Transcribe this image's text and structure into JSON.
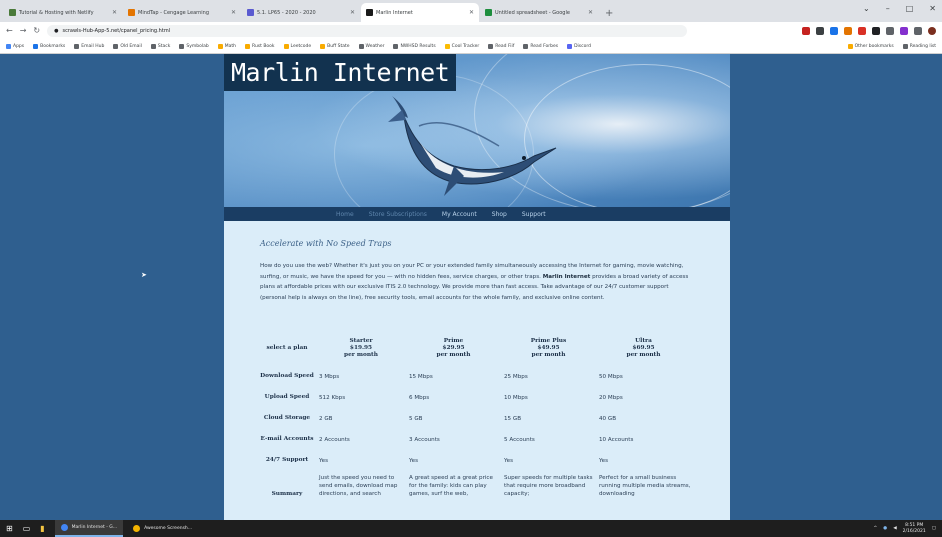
{
  "browser": {
    "tabs": [
      {
        "label": "Tutorial & Hosting with Netlify",
        "color": "#4a7a3a",
        "active": false
      },
      {
        "label": "MindTap - Cengage Learning",
        "color": "#e37400",
        "active": false
      },
      {
        "label": "5.1. LP65 - 2020 - 2020",
        "color": "#5a5ad0",
        "active": false
      },
      {
        "label": "Marlin Internet",
        "color": "#1a1a1a",
        "active": true
      },
      {
        "label": "Untitled spreadsheet - Google",
        "color": "#1e8e3e",
        "active": false
      }
    ],
    "new_tab": "+",
    "window_controls": [
      "⌄",
      "–",
      "□",
      "✕"
    ],
    "url": "scrawls-Hub-App-5.net/cpanel_pricing.html",
    "bookmarks": [
      {
        "label": "Apps",
        "color": "#4285f4"
      },
      {
        "label": "Bookmarks",
        "color": "#1a73e8"
      },
      {
        "label": "Email Hub",
        "color": "#5f6368"
      },
      {
        "label": "Old Email",
        "color": "#5f6368"
      },
      {
        "label": "Stack",
        "color": "#5f6368"
      },
      {
        "label": "Symbolab",
        "color": "#5f6368"
      },
      {
        "label": "Math",
        "color": "#f9ab00"
      },
      {
        "label": "Rust Book",
        "color": "#f9ab00"
      },
      {
        "label": "Leetcode",
        "color": "#f9ab00"
      },
      {
        "label": "Buff State",
        "color": "#f9ab00"
      },
      {
        "label": "Weather",
        "color": "#5f6368"
      },
      {
        "label": "NWHSD Results",
        "color": "#5f6368"
      },
      {
        "label": "Cool Tracker",
        "color": "#fbbc04"
      },
      {
        "label": "Read Fiif",
        "color": "#5f6368"
      },
      {
        "label": "Read Forbes",
        "color": "#5f6368"
      },
      {
        "label": "Discord",
        "color": "#5865f2"
      }
    ],
    "bookmarks_right": [
      "Other bookmarks",
      "Reading list"
    ]
  },
  "site": {
    "title": "Marlin Internet",
    "nav": [
      {
        "label": "Home",
        "faded": true
      },
      {
        "label": "Store Subscriptions",
        "faded": true
      },
      {
        "label": "My Account",
        "faded": false
      },
      {
        "label": "Shop",
        "faded": false
      },
      {
        "label": "Support",
        "faded": false
      }
    ],
    "headline": "Accelerate with No Speed Traps",
    "intro_before": "How do you use the web? Whether it's just you on your PC or your extended family simultaneously accessing the Internet for gaming, movie watching, surfing, or music, we have the speed for you — with no hidden fees, service charges, or other traps. ",
    "intro_brand": "Marlin Internet",
    "intro_after": " provides a broad variety of access plans at affordable prices with our exclusive ITIS 2.0 technology. We provide more than fast access. Take advantage of our 24/7 customer support (personal help is always on the line), free security tools, email accounts for the whole family, and exclusive online content."
  },
  "plans": {
    "select_label": "select a plan",
    "columns": [
      {
        "name": "Starter",
        "price": "$19.95",
        "period": "per month"
      },
      {
        "name": "Prime",
        "price": "$29.95",
        "period": "per month"
      },
      {
        "name": "Prime Plus",
        "price": "$49.95",
        "period": "per month"
      },
      {
        "name": "Ultra",
        "price": "$69.95",
        "period": "per month"
      }
    ],
    "rows": [
      {
        "label": "Download Speed",
        "values": [
          "3 Mbps",
          "15 Mbps",
          "25 Mbps",
          "50 Mbps"
        ]
      },
      {
        "label": "Upload Speed",
        "values": [
          "512 Kbps",
          "6 Mbps",
          "10 Mbps",
          "20 Mbps"
        ]
      },
      {
        "label": "Cloud Storage",
        "values": [
          "2 GB",
          "5 GB",
          "15 GB",
          "40 GB"
        ]
      },
      {
        "label": "E-mail Accounts",
        "values": [
          "2 Accounts",
          "3 Accounts",
          "5 Accounts",
          "10 Accounts"
        ]
      },
      {
        "label": "24/7 Support",
        "values": [
          "Yes",
          "Yes",
          "Yes",
          "Yes"
        ]
      }
    ],
    "summary_label": "Summary",
    "summaries": [
      "Just the speed you need to send emails, download map directions, and search",
      "A great speed at a great price for the family: kids can play games, surf the web,",
      "Super speeds for multiple tasks that require more broadband capacity;",
      "Perfect for a small business running multiple media streams, downloading"
    ]
  },
  "taskbar": {
    "apps": [
      {
        "label": "Marlin Internet - G...",
        "color": "#4285f4",
        "active": true
      },
      {
        "label": "Awesome Screensh...",
        "color": "#f4b400",
        "active": false
      }
    ],
    "time": "8:51 PM",
    "date": "2/16/2021"
  }
}
